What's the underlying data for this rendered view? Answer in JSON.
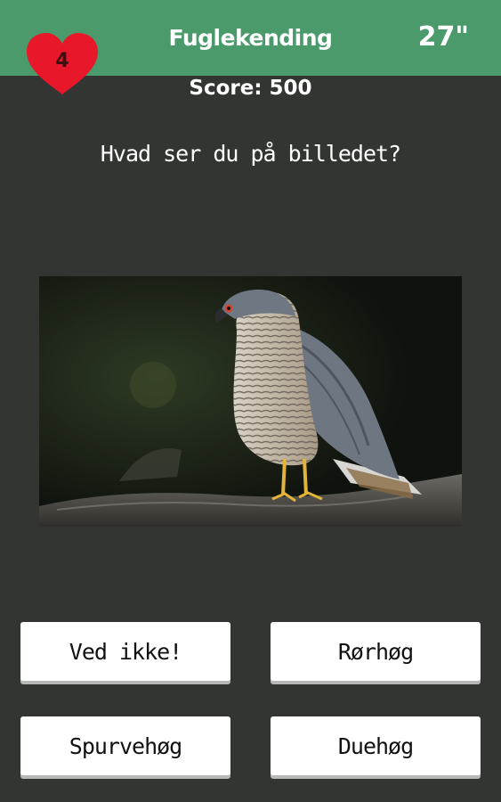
{
  "header": {
    "title": "Fuglekending",
    "timer": "27\"",
    "lives": "4",
    "lives_icon": "heart-icon",
    "bar_color": "#4a9a6c",
    "heart_color": "#e8172a"
  },
  "score_text": "Score: 500",
  "question": "Hvad ser du på billedet?",
  "answers": [
    {
      "label": "Ved ikke!"
    },
    {
      "label": "Rørhøg"
    },
    {
      "label": "Spurvehøg"
    },
    {
      "label": "Duehøg"
    }
  ]
}
